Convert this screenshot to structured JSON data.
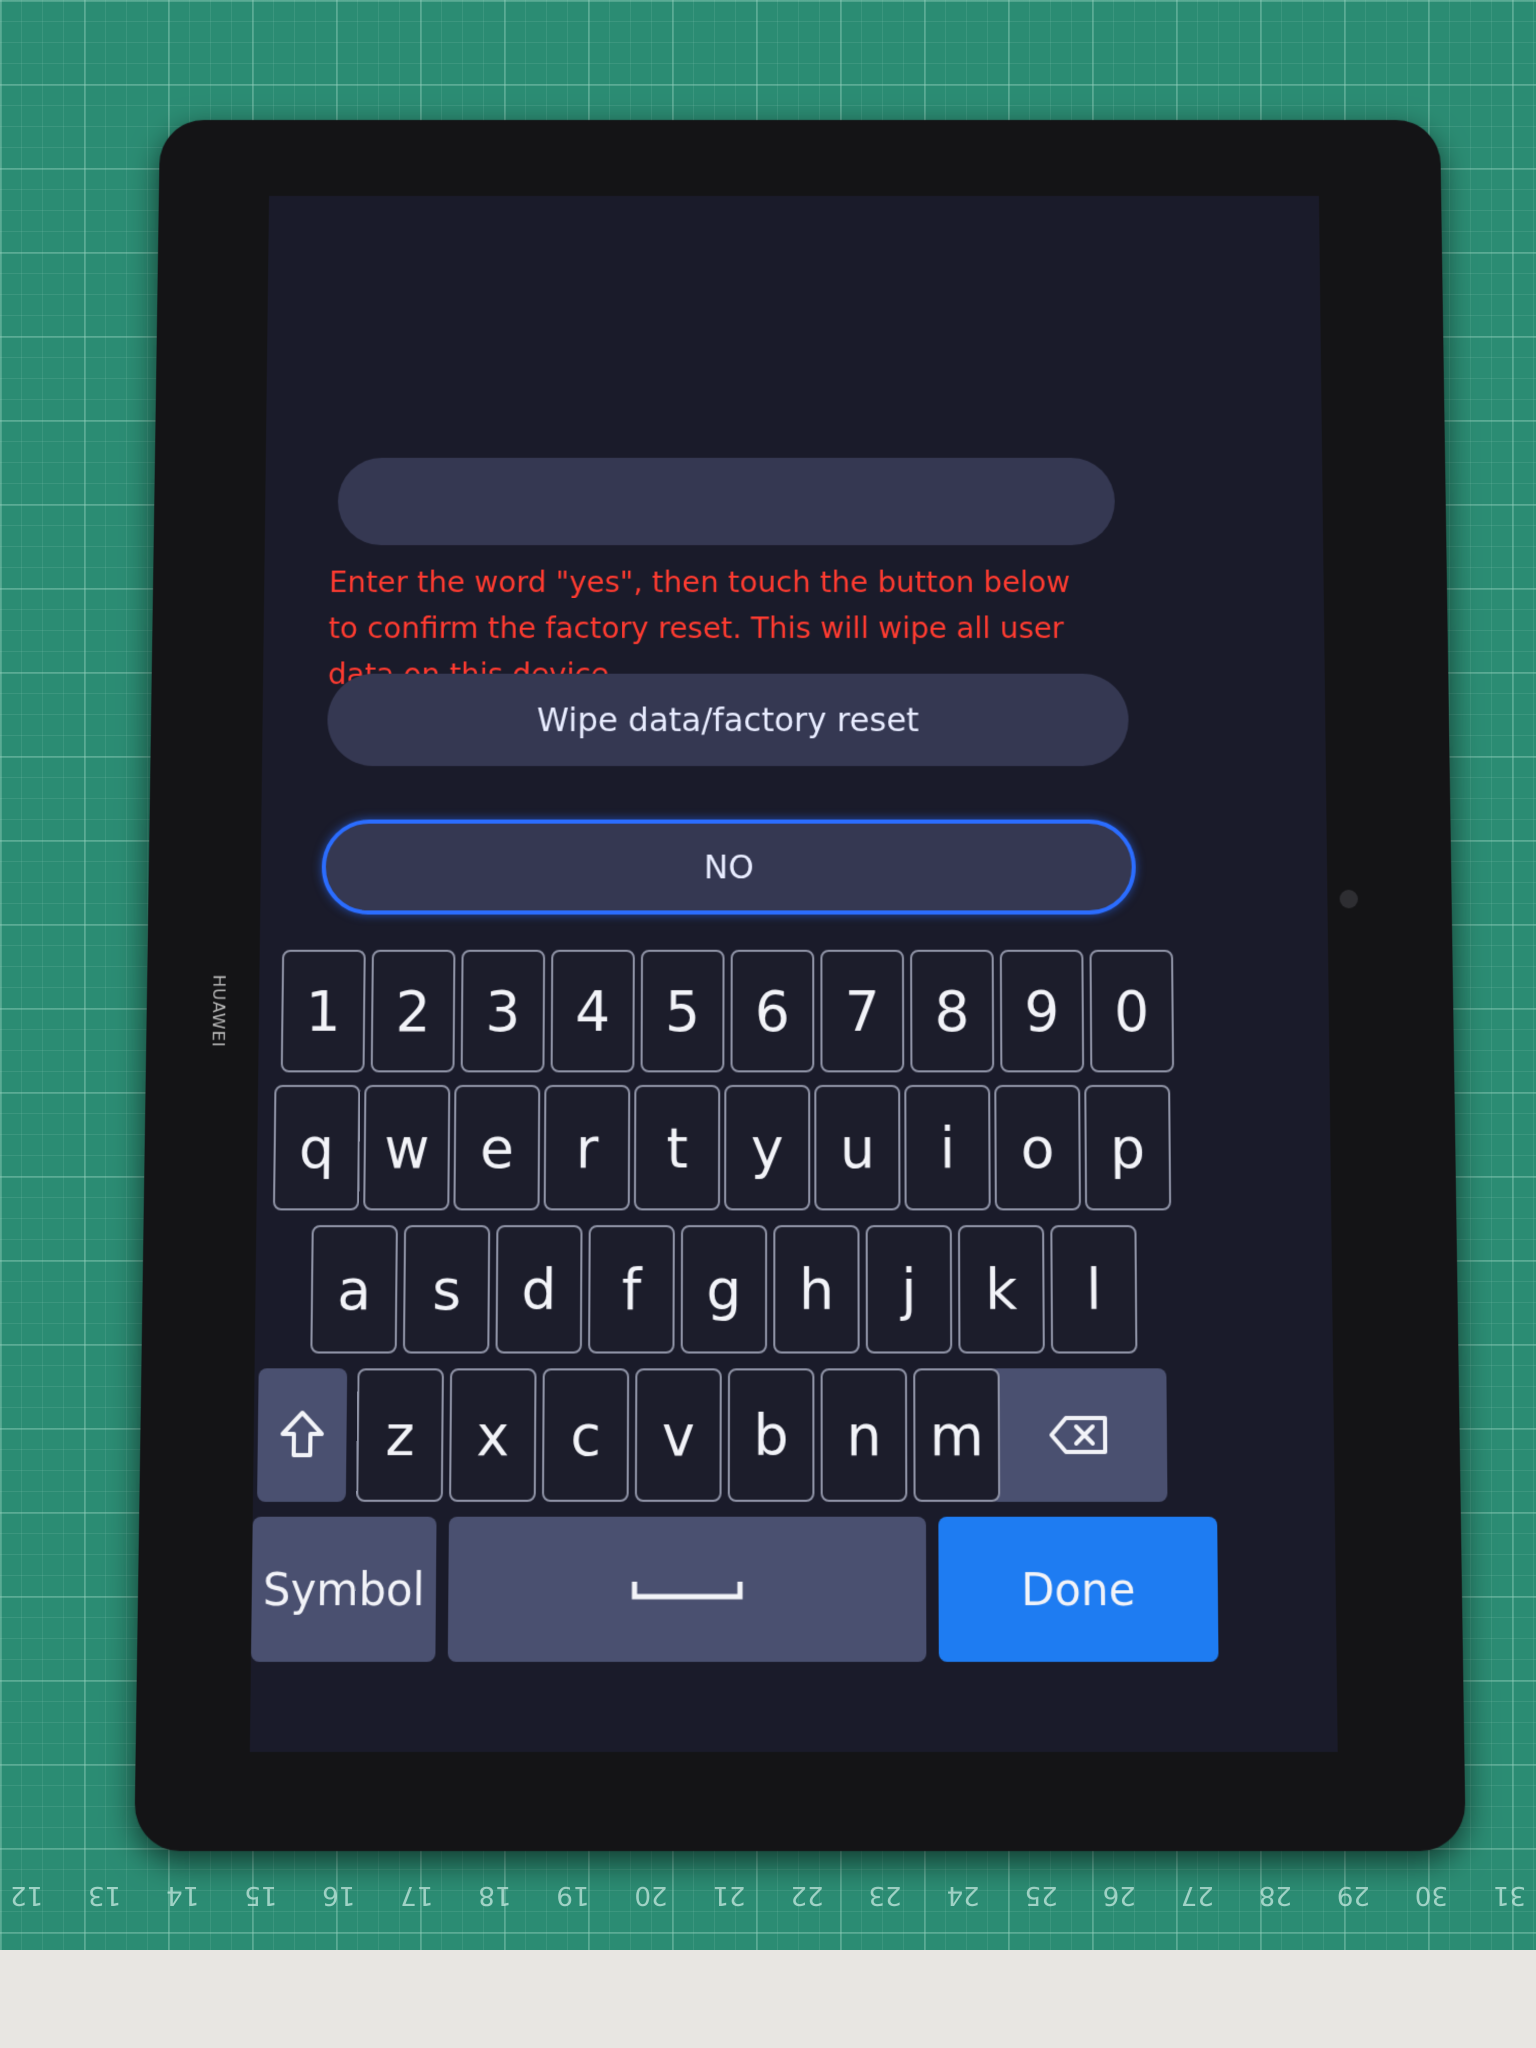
{
  "device": {
    "brand": "HUAWEI"
  },
  "screen": {
    "input": {
      "value": ""
    },
    "warning_text": "Enter the word \"yes\", then touch the button below to confirm the factory reset. This will wipe all user data on this device.",
    "wipe_button_label": "Wipe data/factory reset",
    "no_button_label": "NO"
  },
  "keyboard": {
    "row_numbers": [
      "1",
      "2",
      "3",
      "4",
      "5",
      "6",
      "7",
      "8",
      "9",
      "0"
    ],
    "row_top": [
      "q",
      "w",
      "e",
      "r",
      "t",
      "y",
      "u",
      "i",
      "o",
      "p"
    ],
    "row_middle": [
      "a",
      "s",
      "d",
      "f",
      "g",
      "h",
      "j",
      "k",
      "l"
    ],
    "row_bottom": [
      "z",
      "x",
      "c",
      "v",
      "b",
      "n",
      "m"
    ],
    "shift_icon": "shift-arrow-icon",
    "backspace_icon": "backspace-icon",
    "symbol_label": "Symbol",
    "space_icon": "space-bar-icon",
    "done_label": "Done",
    "colors": {
      "done": "#1e7cf2",
      "function_key": "#4a5070",
      "warning": "#ff3b30",
      "focus_border": "#2b6dff"
    }
  },
  "ruler": {
    "numbers": [
      "31",
      "30",
      "29",
      "28",
      "27",
      "26",
      "25",
      "24",
      "23",
      "22",
      "21",
      "20",
      "19",
      "18",
      "17",
      "16",
      "15",
      "14",
      "13",
      "12"
    ]
  }
}
